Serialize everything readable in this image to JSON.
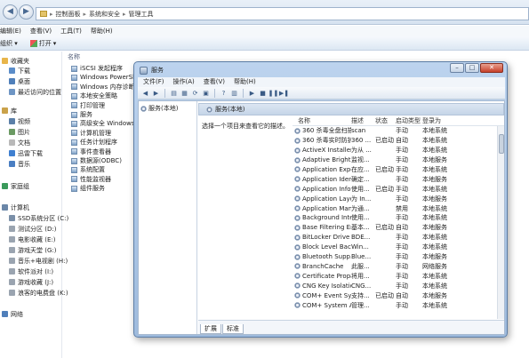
{
  "explorer": {
    "breadcrumbs": [
      "控制面板",
      "系统和安全",
      "管理工具"
    ],
    "menu": [
      "编辑(E)",
      "查看(V)",
      "工具(T)",
      "帮助(H)"
    ],
    "cmd": {
      "organize": "组织",
      "open": "打开"
    },
    "nav": [
      {
        "label": "收藏夹",
        "color": "#e8b54a"
      },
      {
        "label": "下载",
        "color": "#5b8dc9"
      },
      {
        "label": "桌面",
        "color": "#4f7fba"
      },
      {
        "label": "最近访问的位置",
        "color": "#6e95c4"
      },
      {
        "label": "库",
        "color": "#caa24a"
      },
      {
        "label": "视频",
        "color": "#5b7fa8"
      },
      {
        "label": "图片",
        "color": "#6b9a63"
      },
      {
        "label": "文档",
        "color": "#b9b9b9"
      },
      {
        "label": "迅雷下载",
        "color": "#3f7fd0"
      },
      {
        "label": "音乐",
        "color": "#4a7ec2"
      },
      {
        "label": "家庭组",
        "color": "#3a9a5b"
      },
      {
        "label": "计算机",
        "color": "#6b87a8"
      },
      {
        "label": "SSD系统分区 (C:)",
        "color": "#7a8fa8"
      },
      {
        "label": "测试分区 (D:)",
        "color": "#9aa4b0"
      },
      {
        "label": "电影收藏 (E:)",
        "color": "#9aa4b0"
      },
      {
        "label": "游戏天堂 (G:)",
        "color": "#9aa4b0"
      },
      {
        "label": "音乐+电视剧 (H:)",
        "color": "#9aa4b0"
      },
      {
        "label": "软件派对 (I:)",
        "color": "#9aa4b0"
      },
      {
        "label": "游戏收藏 (J:)",
        "color": "#9aa4b0"
      },
      {
        "label": "浪客的电费盘 (K:)",
        "color": "#9aa4b0"
      },
      {
        "label": "网络",
        "color": "#4f7fba"
      }
    ],
    "column_header": "名称",
    "files": [
      "iSCSI 发起程序",
      "Windows PowerShell",
      "Windows 内存诊断",
      "本地安全策略",
      "打印管理",
      "服务",
      "高级安全 Windows 防",
      "计算机管理",
      "任务计划程序",
      "事件查看器",
      "数据源(ODBC)",
      "系统配置",
      "性能监视器",
      "组件服务"
    ]
  },
  "services": {
    "title": "服务",
    "menu": [
      "文件(F)",
      "操作(A)",
      "查看(V)",
      "帮助(H)"
    ],
    "tree_root": "服务(本地)",
    "panel_title": "服务(本地)",
    "description_hint": "选择一个项目来查看它的描述。",
    "columns": {
      "name": "名称",
      "desc": "描述",
      "status": "状态",
      "startup": "启动类型",
      "logon": "登录为"
    },
    "rows": [
      {
        "name": "360 杀毒全盘扫描...",
        "desc": "scan",
        "status": "",
        "startup": "手动",
        "logon": "本地系统"
      },
      {
        "name": "360 杀毒实时防护...",
        "desc": "360 ...",
        "status": "已启动",
        "startup": "自动",
        "logon": "本地系统"
      },
      {
        "name": "ActiveX Installer ...",
        "desc": "为从 ...",
        "status": "",
        "startup": "手动",
        "logon": "本地系统"
      },
      {
        "name": "Adaptive Brightn...",
        "desc": "监视...",
        "status": "",
        "startup": "手动",
        "logon": "本地服务"
      },
      {
        "name": "Application Expe...",
        "desc": "在应...",
        "status": "已启动",
        "startup": "手动",
        "logon": "本地系统"
      },
      {
        "name": "Application Iden...",
        "desc": "确定...",
        "status": "",
        "startup": "手动",
        "logon": "本地服务"
      },
      {
        "name": "Application Infor...",
        "desc": "使用...",
        "status": "已启动",
        "startup": "手动",
        "logon": "本地系统"
      },
      {
        "name": "Application Laye...",
        "desc": "为 In...",
        "status": "",
        "startup": "手动",
        "logon": "本地服务"
      },
      {
        "name": "Application Man...",
        "desc": "为通...",
        "status": "",
        "startup": "禁用",
        "logon": "本地系统"
      },
      {
        "name": "Background Inte...",
        "desc": "使用...",
        "status": "",
        "startup": "手动",
        "logon": "本地系统"
      },
      {
        "name": "Base Filtering En...",
        "desc": "基本...",
        "status": "已启动",
        "startup": "自动",
        "logon": "本地服务"
      },
      {
        "name": "BitLocker Drive ...",
        "desc": "BDE...",
        "status": "",
        "startup": "手动",
        "logon": "本地系统"
      },
      {
        "name": "Block Level Back...",
        "desc": "Win...",
        "status": "",
        "startup": "手动",
        "logon": "本地系统"
      },
      {
        "name": "Bluetooth Supp...",
        "desc": "Blue...",
        "status": "",
        "startup": "手动",
        "logon": "本地服务"
      },
      {
        "name": "BranchCache",
        "desc": "此服...",
        "status": "",
        "startup": "手动",
        "logon": "网络服务"
      },
      {
        "name": "Certificate Propa...",
        "desc": "将用...",
        "status": "",
        "startup": "手动",
        "logon": "本地系统"
      },
      {
        "name": "CNG Key Isolation",
        "desc": "CNG...",
        "status": "",
        "startup": "手动",
        "logon": "本地系统"
      },
      {
        "name": "COM+ Event Sys...",
        "desc": "支持...",
        "status": "已启动",
        "startup": "自动",
        "logon": "本地服务"
      },
      {
        "name": "COM+ System A...",
        "desc": "管理...",
        "status": "",
        "startup": "手动",
        "logon": "本地系统"
      }
    ],
    "tabs": [
      "扩展",
      "标准"
    ]
  }
}
